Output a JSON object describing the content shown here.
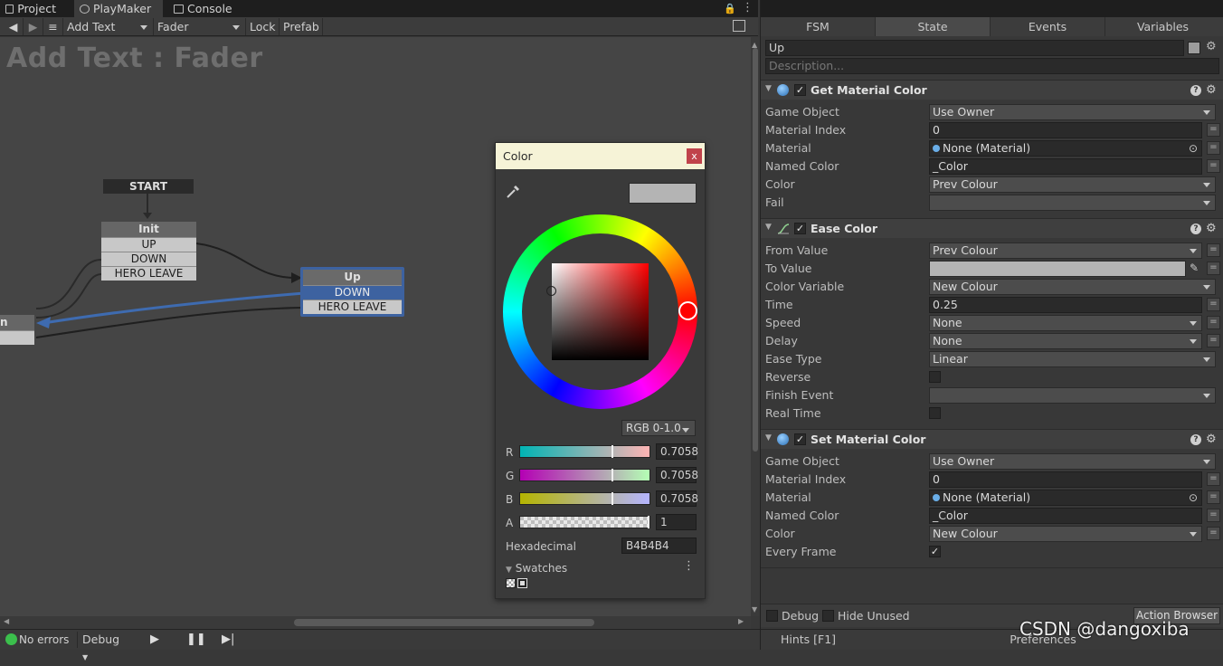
{
  "top_tabs": [
    {
      "label": "Project"
    },
    {
      "label": "PlayMaker"
    },
    {
      "label": "Console"
    }
  ],
  "fsm_toolbar": {
    "gameobject_select": "Add Text",
    "fsm_select": "Fader",
    "lock_label": "Lock",
    "prefab_label": "Prefab"
  },
  "canvas": {
    "title": "Add Text : Fader",
    "start_label": "START",
    "nodes": {
      "init": {
        "title": "Init",
        "events": [
          "UP",
          "DOWN",
          "HERO LEAVE"
        ]
      },
      "up": {
        "title": "Up",
        "events": [
          "DOWN",
          "HERO LEAVE"
        ]
      },
      "partial": {
        "title": "n"
      }
    }
  },
  "color_picker": {
    "title": "Color",
    "close_label": "x",
    "mode": "RGB 0-1.0",
    "channels": [
      {
        "label": "R",
        "value": "0.7058"
      },
      {
        "label": "G",
        "value": "0.7058"
      },
      {
        "label": "B",
        "value": "0.7058"
      },
      {
        "label": "A",
        "value": "1"
      }
    ],
    "hex_label": "Hexadecimal",
    "hex_value": "B4B4B4",
    "swatches_label": "Swatches",
    "current_color": "#b4b4b4"
  },
  "bottom_bar": {
    "status": "No errors",
    "debug_label": "Debug"
  },
  "right_tabs": [
    {
      "label": "FSM"
    },
    {
      "label": "State",
      "active": true
    },
    {
      "label": "Events"
    },
    {
      "label": "Variables"
    }
  ],
  "state": {
    "name": "Up",
    "description_placeholder": "Description...",
    "actions": [
      {
        "title": "Get Material Color",
        "rows": [
          {
            "label": "Game Object",
            "value": "Use Owner"
          },
          {
            "label": "Material Index",
            "value": "0"
          },
          {
            "label": "Material",
            "value": "None (Material)"
          },
          {
            "label": "Named Color",
            "value": "_Color"
          },
          {
            "label": "Color",
            "value": "Prev Colour"
          },
          {
            "label": "Fail",
            "value": ""
          }
        ]
      },
      {
        "title": "Ease Color",
        "rows": [
          {
            "label": "From Value",
            "value": "Prev Colour"
          },
          {
            "label": "To Value",
            "value": ""
          },
          {
            "label": "Color Variable",
            "value": "New Colour"
          },
          {
            "label": "Time",
            "value": "0.25"
          },
          {
            "label": "Speed",
            "value": "None"
          },
          {
            "label": "Delay",
            "value": "None"
          },
          {
            "label": "Ease Type",
            "value": "Linear"
          },
          {
            "label": "Reverse",
            "value": ""
          },
          {
            "label": "Finish Event",
            "value": ""
          },
          {
            "label": "Real Time",
            "value": ""
          }
        ]
      },
      {
        "title": "Set Material Color",
        "rows": [
          {
            "label": "Game Object",
            "value": "Use Owner"
          },
          {
            "label": "Material Index",
            "value": "0"
          },
          {
            "label": "Material",
            "value": "None (Material)"
          },
          {
            "label": "Named Color",
            "value": "_Color"
          },
          {
            "label": "Color",
            "value": "New Colour"
          },
          {
            "label": "Every Frame",
            "value": ""
          }
        ]
      }
    ]
  },
  "inspector_footer": {
    "debug_label": "Debug",
    "hide_unused_label": "Hide Unused",
    "action_browser_label": "Action Browser",
    "hints_label": "Hints [F1]",
    "preferences_label": "Preferences"
  },
  "watermark": "CSDN @dangoxiba"
}
